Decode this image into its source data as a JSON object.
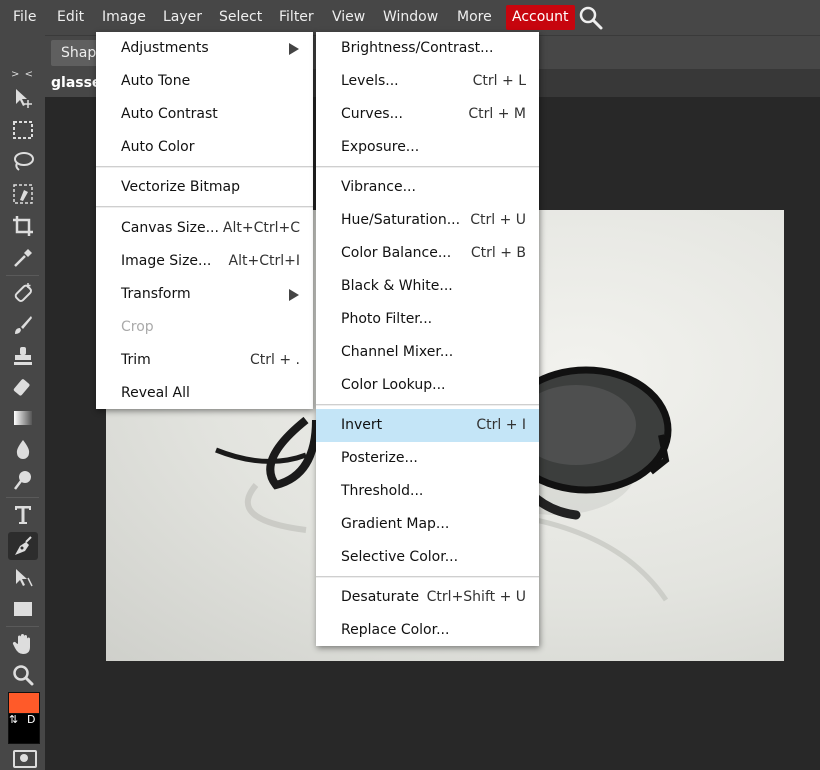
{
  "menubar": {
    "items": [
      "File",
      "Edit",
      "Image",
      "Layer",
      "Select",
      "Filter",
      "View",
      "Window",
      "More"
    ],
    "account": "Account",
    "search_icon": "search-icon"
  },
  "options_bar": {
    "shape_mode": "Shape"
  },
  "document": {
    "tab_title": "glasses"
  },
  "toolbar": {
    "collapse_label": "> <",
    "colors": {
      "foreground": "#ff5a29",
      "background": "#000000"
    },
    "swap_label": "⇅",
    "default_label": "D"
  },
  "image_menu": {
    "items": [
      {
        "label": "Adjustments"
      },
      {
        "label": "Auto Tone"
      },
      {
        "label": "Auto Contrast"
      },
      {
        "label": "Auto Color"
      },
      {
        "label": "Vectorize Bitmap"
      },
      {
        "label": "Canvas Size...",
        "shortcut": "Alt+Ctrl+C"
      },
      {
        "label": "Image Size...",
        "shortcut": "Alt+Ctrl+I"
      },
      {
        "label": "Transform"
      },
      {
        "label": "Crop"
      },
      {
        "label": "Trim",
        "shortcut": "Ctrl + ."
      },
      {
        "label": "Reveal All"
      }
    ]
  },
  "adjustments_menu": {
    "items": [
      {
        "label": "Brightness/Contrast..."
      },
      {
        "label": "Levels...",
        "shortcut": "Ctrl + L"
      },
      {
        "label": "Curves...",
        "shortcut": "Ctrl + M"
      },
      {
        "label": "Exposure..."
      },
      {
        "label": "Vibrance..."
      },
      {
        "label": "Hue/Saturation...",
        "shortcut": "Ctrl + U"
      },
      {
        "label": "Color Balance...",
        "shortcut": "Ctrl + B"
      },
      {
        "label": "Black & White..."
      },
      {
        "label": "Photo Filter..."
      },
      {
        "label": "Channel Mixer..."
      },
      {
        "label": "Color Lookup..."
      },
      {
        "label": "Invert",
        "shortcut": "Ctrl + I"
      },
      {
        "label": "Posterize..."
      },
      {
        "label": "Threshold..."
      },
      {
        "label": "Gradient Map..."
      },
      {
        "label": "Selective Color..."
      },
      {
        "label": "Desaturate",
        "shortcut": "Ctrl+Shift + U"
      },
      {
        "label": "Replace Color..."
      }
    ]
  },
  "colors": {
    "accent_account": "#c7050e",
    "highlight": "#c4e5f7"
  }
}
